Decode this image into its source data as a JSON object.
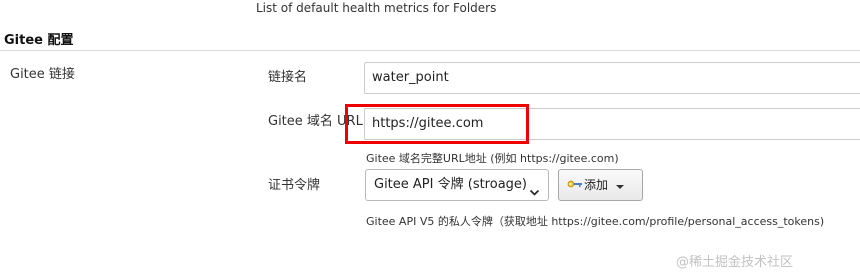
{
  "header": {
    "description": "List of default health metrics for Folders"
  },
  "section": {
    "title": "Gitee 配置",
    "group_label": "Gitee 链接"
  },
  "fields": {
    "link_name": {
      "label": "链接名",
      "value": "water_point"
    },
    "domain_url": {
      "label": "Gitee 域名 URL",
      "value": "https://gitee.com",
      "help": "Gitee 域名完整URL地址 (例如 https://gitee.com)"
    },
    "certificate_token": {
      "label": "证书令牌",
      "selected": "Gitee API 令牌 (stroage)",
      "add_button": "添加",
      "help": "Gitee API V5 的私人令牌（获取地址 https://gitee.com/profile/personal_access_tokens)"
    }
  },
  "icons": {
    "add_button_icon": "key-icon",
    "dropdown": "caret-down-icon"
  },
  "colors": {
    "highlight": "#ee0000"
  },
  "watermark": "@稀土掘金技术社区"
}
